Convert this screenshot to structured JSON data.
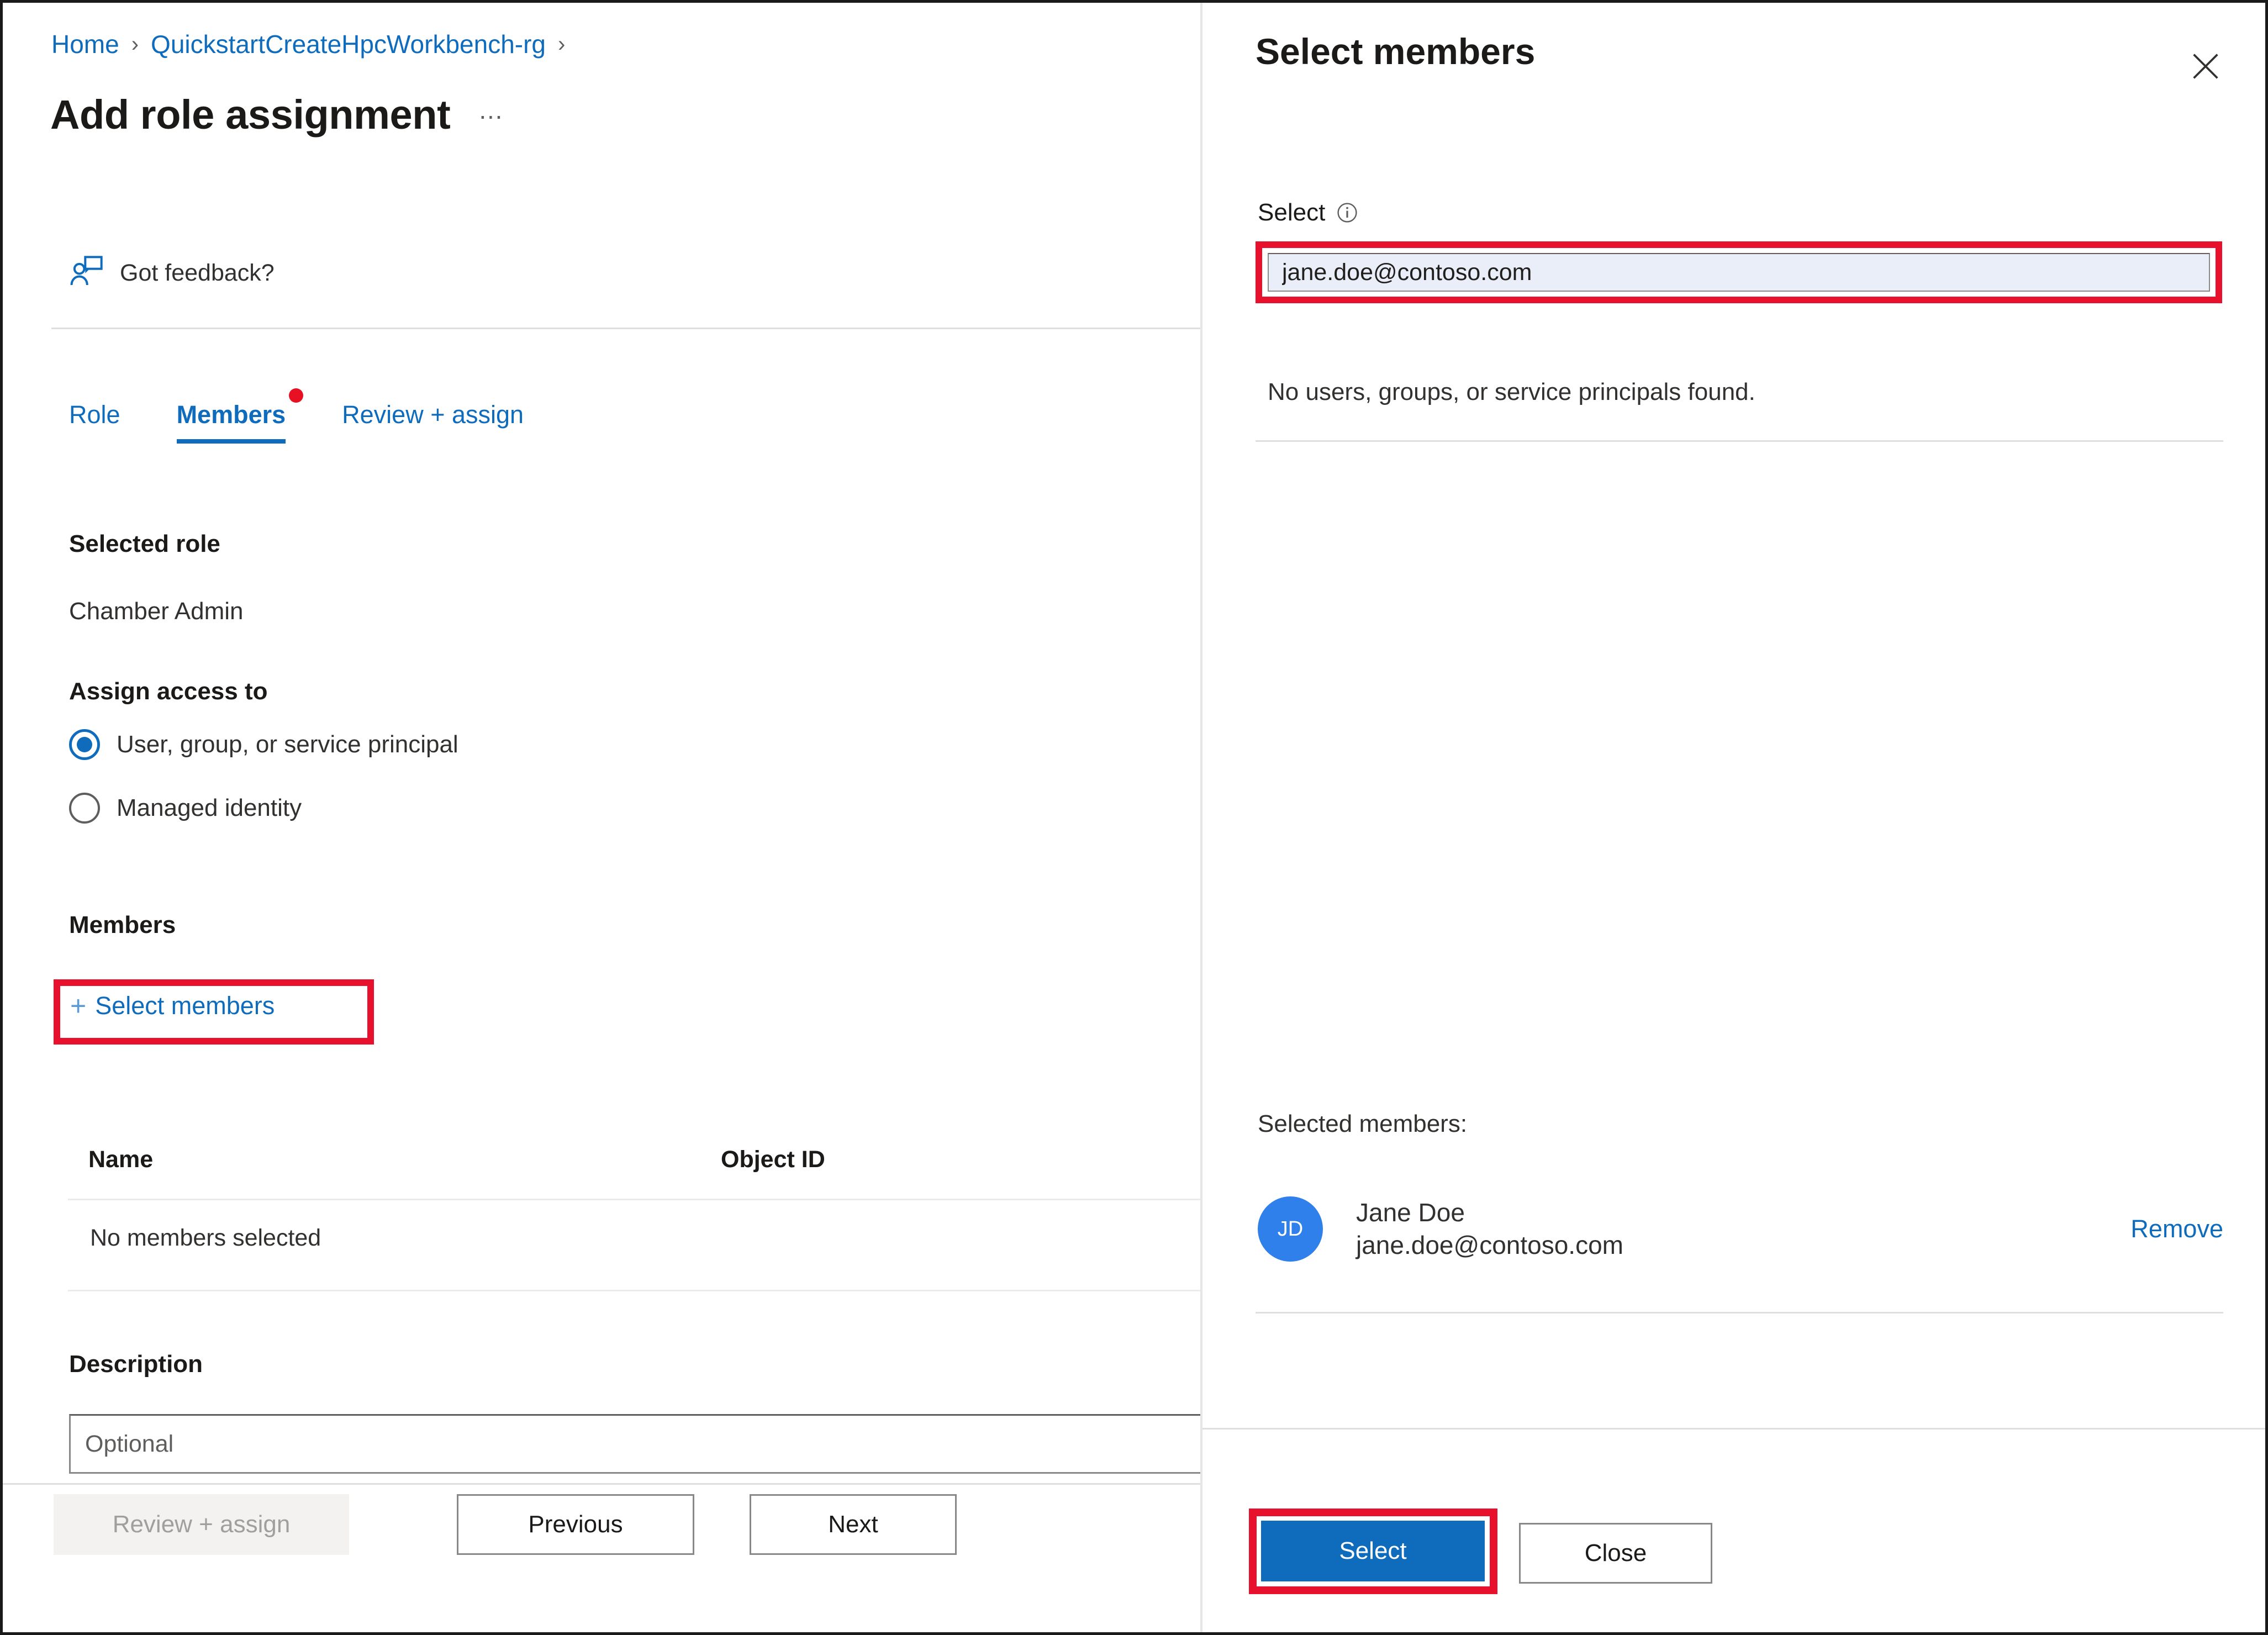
{
  "left_panel": {
    "breadcrumb": {
      "items": [
        "Home",
        "QuickstartCreateHpcWorkbench-rg"
      ],
      "separator": "›",
      "trailing_separator": "›"
    },
    "title": "Add role assignment",
    "more_menu": "…",
    "feedback": {
      "label": "Got feedback?",
      "icon": "feedback-person-icon"
    },
    "tabs": [
      {
        "label": "Role",
        "active": false,
        "badge": false
      },
      {
        "label": "Members",
        "active": true,
        "badge": true
      },
      {
        "label": "Review + assign",
        "active": false,
        "badge": false
      }
    ],
    "selected_role": {
      "heading": "Selected role",
      "value": "Chamber Admin"
    },
    "assign_access_to": {
      "heading": "Assign access to",
      "options": [
        {
          "label": "User, group, or service principal",
          "checked": true
        },
        {
          "label": "Managed identity",
          "checked": false
        }
      ]
    },
    "members": {
      "heading": "Members",
      "select_members_link": "Select members",
      "plus_glyph": "+",
      "table": {
        "columns": [
          "Name",
          "Object ID"
        ],
        "rows": [
          [
            "No members selected",
            ""
          ]
        ]
      }
    },
    "description": {
      "heading": "Description",
      "value": "",
      "placeholder": "Optional"
    },
    "footer_buttons": [
      {
        "label": "Review + assign",
        "state": "disabled"
      },
      {
        "label": "Previous",
        "state": "default"
      },
      {
        "label": "Next",
        "state": "default"
      }
    ]
  },
  "right_panel": {
    "title": "Select members",
    "close_icon": "close-icon",
    "select_field": {
      "label": "Select",
      "info_icon": "info-icon",
      "value": "jane.doe@contoso.com",
      "placeholder": ""
    },
    "no_results_text": "No users, groups, or service principals found.",
    "selected_members_heading": "Selected members:",
    "selected_members": [
      {
        "initials": "JD",
        "name": "Jane Doe",
        "email": "jane.doe@contoso.com",
        "remove_label": "Remove"
      }
    ],
    "footer_buttons": [
      {
        "label": "Select",
        "state": "primary"
      },
      {
        "label": "Close",
        "state": "default"
      }
    ]
  },
  "colors": {
    "accent_blue": "#0f6cbd",
    "highlight_red": "#e8112d",
    "badge_red": "#e81123",
    "avatar_blue": "#2f80ea",
    "input_fill": "#e9eef8",
    "text_primary": "#1b1a19",
    "text_secondary": "#323130",
    "divider": "#e1dfdd"
  }
}
